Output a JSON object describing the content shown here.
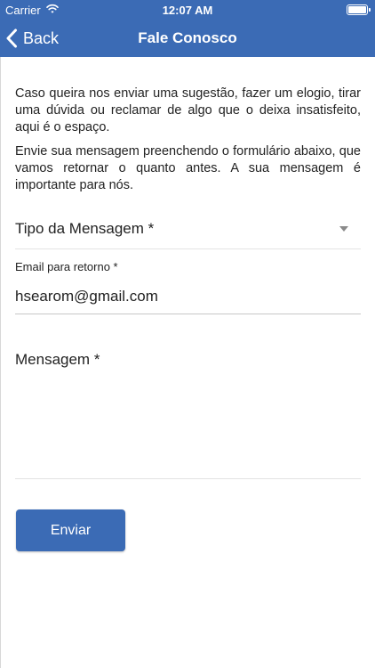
{
  "status_bar": {
    "carrier": "Carrier",
    "time": "12:07 AM",
    "wifi_icon": "wifi-icon",
    "battery_icon": "battery-icon"
  },
  "nav": {
    "back_label": "Back",
    "back_icon": "chevron-left-icon",
    "title": "Fale Conosco"
  },
  "intro": {
    "paragraph1": "Caso queira nos enviar uma sugestão, fazer um elogio, tirar uma dúvida ou reclamar de algo que o deixa insatisfeito, aqui é o espaço.",
    "paragraph2": "Envie sua mensagem preenchendo o formulário abaixo, que vamos retornar o quanto antes. A sua mensagem é importante para nós."
  },
  "form": {
    "message_type_label": "Tipo da Mensagem *",
    "email_label": "Email para retorno *",
    "email_value": "hsearom@gmail.com",
    "message_label": "Mensagem *",
    "submit_label": "Enviar"
  },
  "colors": {
    "brand": "#3b6bb5"
  }
}
